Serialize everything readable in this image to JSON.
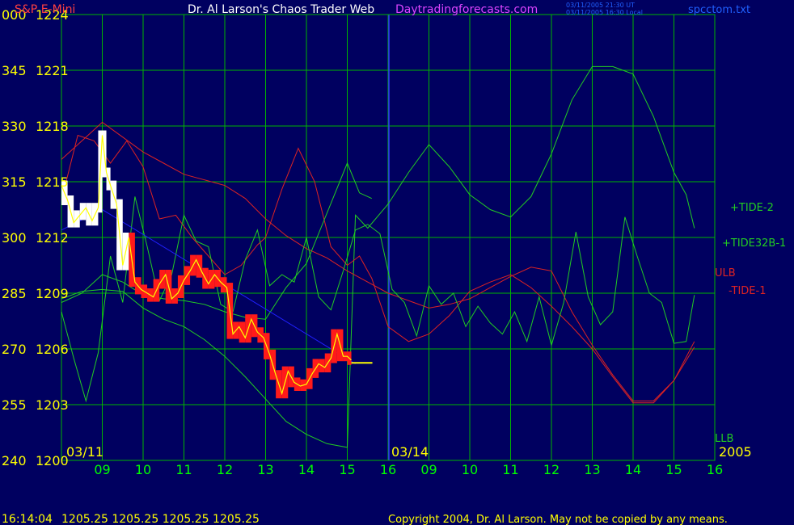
{
  "header": {
    "title_left": "S&P E-Mini",
    "title_center": "Dr. Al Larson's Chaos Trader Web",
    "title_site": "Daytradingforecasts.com",
    "time_ut": "03/11/2005 21:30 UT",
    "time_local": "03/11/2005 16:30 Local",
    "file": "spcctom.txt"
  },
  "footer": {
    "time": "16:14:04",
    "prices": "1205.25  1205.25  1205.25  1205.25",
    "copyright": "Copyright 2004, Dr. Al Larson. May not be copied by any means."
  },
  "colors": {
    "background": "#000060",
    "grid": "#00b400",
    "axis_text": "#ffff00",
    "time_text": "#00ff00",
    "price_bars": "#ff1a1a",
    "recent_bars": "#ffffff",
    "average": "#ffff00",
    "trend": "#2020ff",
    "tide_green": "#22cc22",
    "tide_red": "#dd2222",
    "brand": "#dd44ff"
  },
  "chart_data": {
    "type": "line",
    "y_price_labels": [
      "1224",
      "1221",
      "1218",
      "1215",
      "1212",
      "1209",
      "1206",
      "1203",
      "1200"
    ],
    "y_angle_labels": [
      "000",
      "345",
      "330",
      "315",
      "300",
      "285",
      "270",
      "255",
      "240"
    ],
    "ylim": [
      1200,
      1224
    ],
    "x_labels": [
      "09",
      "10",
      "11",
      "12",
      "13",
      "14",
      "15",
      "16",
      "09",
      "10",
      "11",
      "12",
      "13",
      "14",
      "15",
      "16"
    ],
    "date_labels": [
      "03/11",
      "03/14"
    ],
    "year_label": "2005",
    "series_labels": {
      "tide2": "+TIDE-2",
      "tide32b": "+TIDE32B-1",
      "ulb": "ULB",
      "tide1": "-TIDE-1",
      "llb": "LLB"
    },
    "series": [
      {
        "name": "+TIDE-2",
        "color": "#22cc22",
        "x": [
          0,
          0.5,
          1,
          1.5,
          2,
          2.5,
          3,
          3.5,
          4,
          4.5,
          5,
          5.5,
          6,
          6.5,
          7,
          7.2,
          7.5,
          8,
          8.5,
          9,
          9.5,
          10,
          10.5,
          11,
          11.5,
          12,
          12.5,
          13,
          13.5,
          14,
          14.5,
          15,
          15.3,
          15.5
        ],
        "y": [
          1208.7,
          1209.1,
          1209.2,
          1209.1,
          1208.2,
          1207.6,
          1207.2,
          1206.5,
          1205.6,
          1204.5,
          1203.3,
          1202.1,
          1201.4,
          1200.9,
          1200.7,
          1213.2,
          1212.5,
          1213.8,
          1215.5,
          1217.0,
          1215.8,
          1214.3,
          1213.5,
          1213.1,
          1214.2,
          1216.5,
          1219.4,
          1221.2,
          1221.2,
          1220.8,
          1218.5,
          1215.5,
          1214.3,
          1212.5
        ]
      },
      {
        "name": "ULB",
        "color": "#dd2222",
        "x": [
          0,
          0.5,
          1,
          1.5,
          2,
          2.5,
          3,
          3.5,
          4,
          4.5,
          5,
          5.5,
          6,
          6.5,
          7,
          7.5,
          8,
          8.5,
          9,
          9.5,
          10,
          10.5,
          11,
          11.5,
          12,
          12.5,
          13,
          13.5,
          14,
          14.5,
          15,
          15.5
        ],
        "y": [
          1216.2,
          1217.2,
          1218.2,
          1217.4,
          1216.6,
          1216.0,
          1215.4,
          1215.1,
          1214.8,
          1214.1,
          1213.0,
          1212.1,
          1211.4,
          1210.9,
          1210.2,
          1209.6,
          1209.0,
          1208.6,
          1208.2,
          1208.4,
          1208.7,
          1209.3,
          1209.9,
          1210.4,
          1210.2,
          1208.0,
          1206.2,
          1204.6,
          1203.2,
          1203.2,
          1204.3,
          1206.1
        ]
      },
      {
        "name": "-TIDE-1",
        "color": "#dd2222",
        "x": [
          0,
          0.4,
          0.8,
          1.2,
          1.6,
          2.0,
          2.4,
          2.8,
          3.2,
          3.6,
          4.0,
          4.4,
          4.8,
          5.0,
          5.4,
          5.8,
          6.2,
          6.6,
          7.0,
          7.3,
          7.6,
          8.0,
          8.5,
          9.0,
          9.5,
          10.0,
          10.5,
          11.0,
          11.5,
          12.0,
          12.5,
          13.0,
          13.5,
          14.0,
          14.5,
          15.0,
          15.5
        ],
        "y": [
          1214.0,
          1217.5,
          1217.2,
          1216.0,
          1217.2,
          1215.8,
          1213.0,
          1213.2,
          1212.0,
          1211.0,
          1210.0,
          1210.5,
          1211.6,
          1212.0,
          1214.6,
          1216.8,
          1215.0,
          1211.5,
          1210.5,
          1211.0,
          1209.8,
          1207.2,
          1206.4,
          1206.8,
          1207.8,
          1209.1,
          1209.6,
          1210.0,
          1209.3,
          1208.3,
          1207.2,
          1206.0,
          1204.5,
          1203.1,
          1203.1,
          1204.3,
          1206.4
        ]
      },
      {
        "name": "+TIDE32B-1",
        "color": "#22cc22",
        "x": [
          0,
          0.3,
          0.6,
          0.9,
          1.2,
          1.5,
          1.8,
          2.1,
          2.4,
          2.7,
          3.0,
          3.3,
          3.6,
          3.9,
          4.2,
          4.5,
          4.8,
          5.1,
          5.4,
          5.7,
          6.0,
          6.3,
          6.6,
          6.9,
          7.2,
          7.5,
          7.8,
          8.1,
          8.4,
          8.7,
          9.0,
          9.3,
          9.6,
          9.9,
          10.2,
          10.5,
          10.8,
          11.1,
          11.4,
          11.7,
          12.0,
          12.3,
          12.6,
          12.9,
          13.2,
          13.5,
          13.8,
          14.1,
          14.4,
          14.7,
          15.0,
          15.3,
          15.5
        ],
        "y": [
          1208.0,
          1205.5,
          1203.2,
          1205.8,
          1211.0,
          1208.5,
          1214.2,
          1211.5,
          1208.6,
          1210.0,
          1213.2,
          1211.8,
          1211.5,
          1208.4,
          1208.0,
          1210.8,
          1212.4,
          1209.4,
          1210.0,
          1209.6,
          1212.0,
          1208.8,
          1208.1,
          1210.2,
          1212.4,
          1212.7,
          1212.2,
          1209.2,
          1208.5,
          1206.7,
          1209.4,
          1208.4,
          1209.0,
          1207.2,
          1208.3,
          1207.4,
          1206.8,
          1208.0,
          1206.4,
          1208.8,
          1206.2,
          1208.5,
          1212.3,
          1208.8,
          1207.3,
          1208.0,
          1213.1,
          1211.0,
          1209.0,
          1208.5,
          1206.3,
          1206.4,
          1208.9
        ]
      },
      {
        "name": "LLB",
        "color": "#22cc22",
        "x": [
          0,
          0.5,
          1.0,
          1.5,
          2.0,
          2.5,
          3.0,
          3.5,
          4.0,
          4.5,
          5.0,
          5.5,
          6.0,
          6.5,
          7.0,
          7.3,
          7.6
        ],
        "y": [
          1208.5,
          1209.0,
          1210.0,
          1209.6,
          1208.9,
          1208.7,
          1208.6,
          1208.4,
          1208.0,
          1207.7,
          1207.6,
          1209.3,
          1210.6,
          1213.3,
          1216.0,
          1214.4,
          1214.1
        ]
      }
    ],
    "price": {
      "x": [
        0,
        0.15,
        0.3,
        0.45,
        0.6,
        0.75,
        0.9,
        1.0,
        1.1,
        1.2,
        1.35,
        1.5,
        1.65,
        1.8,
        1.95,
        2.1,
        2.25,
        2.4,
        2.55,
        2.7,
        2.85,
        3.0,
        3.15,
        3.3,
        3.45,
        3.6,
        3.75,
        3.9,
        4.05,
        4.2,
        4.35,
        4.5,
        4.65,
        4.8,
        4.95,
        5.1,
        5.25,
        5.4,
        5.55,
        5.7,
        5.85,
        6.0,
        6.15,
        6.3,
        6.45,
        6.6,
        6.75,
        6.9,
        7.0,
        7.1
      ],
      "y": [
        1214.8,
        1214.0,
        1212.8,
        1213.2,
        1213.6,
        1212.9,
        1213.6,
        1217.5,
        1215.5,
        1214.8,
        1213.8,
        1210.5,
        1212.0,
        1209.6,
        1209.2,
        1209.0,
        1208.8,
        1209.5,
        1210.0,
        1208.7,
        1209.0,
        1209.7,
        1210.2,
        1210.8,
        1210.1,
        1209.5,
        1210.0,
        1209.6,
        1209.3,
        1206.8,
        1207.2,
        1206.6,
        1207.6,
        1206.9,
        1206.6,
        1205.7,
        1204.6,
        1203.6,
        1204.8,
        1204.2,
        1204.0,
        1204.1,
        1204.7,
        1205.2,
        1205.0,
        1205.5,
        1206.8,
        1205.6,
        1205.6,
        1205.4
      ]
    },
    "trend": {
      "x": [
        0,
        1.0,
        7.2
      ],
      "y": [
        1212.4,
        1213.5,
        1205.2
      ]
    },
    "last_price": 1205.25
  }
}
